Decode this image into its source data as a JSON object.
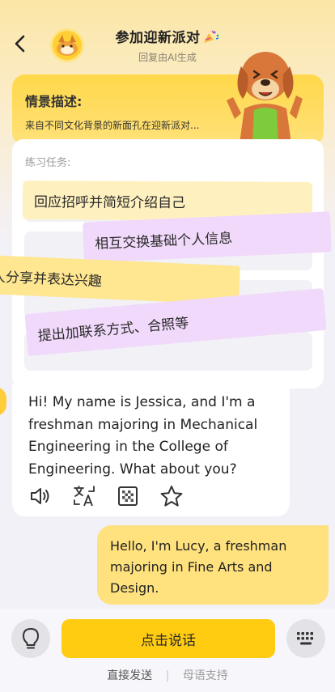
{
  "header": {
    "title": "参加迎新派对",
    "subtitle": "回复由AI生成"
  },
  "scene": {
    "title": "情景描述:",
    "description": "来自不同文化背景的新面孔在迎新派对..."
  },
  "tasks": {
    "label": "练习任务:",
    "items": [
      "回应招呼并简短介绍自己",
      "相互交换基础个人信息",
      "和别人分享并表达兴趣",
      "提出加联系方式、合照等"
    ]
  },
  "ai_message": {
    "text": "Hi! My name is Jessica, and I'm a freshman majoring in Mechanical Engineering in the College of Engineering. What about you?"
  },
  "user_message": {
    "text": "Hello, I'm Lucy, a freshman majoring in Fine Arts and Design."
  },
  "bottom": {
    "speak_label": "点击说话",
    "send_direct": "直接发送",
    "separator": "|",
    "native_support": "母语支持"
  },
  "colors": {
    "accent_yellow": "#ffcc12",
    "sticky_yellow": "#fff1bf",
    "sticky_purple": "#f1d9fb"
  }
}
